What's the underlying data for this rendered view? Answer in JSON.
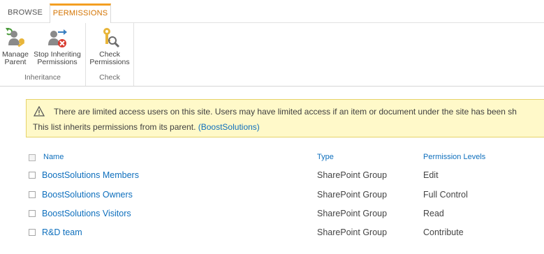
{
  "tabs": [
    {
      "label": "BROWSE",
      "active": false
    },
    {
      "label": "PERMISSIONS",
      "active": true
    }
  ],
  "ribbon": {
    "inheritance_group": {
      "label": "Inheritance",
      "buttons": [
        {
          "label_line1": "Manage",
          "label_line2": "Parent",
          "icon": "manage-parent-icon"
        },
        {
          "label_line1": "Stop Inheriting",
          "label_line2": "Permissions",
          "icon": "stop-inheriting-icon"
        }
      ]
    },
    "check_group": {
      "label": "Check",
      "buttons": [
        {
          "label_line1": "Check",
          "label_line2": "Permissions",
          "icon": "check-permissions-icon"
        }
      ]
    }
  },
  "warning": {
    "line1": "There are limited access users on this site. Users may have limited access if an item or document under the site has been sh",
    "line2_prefix": "This list inherits permissions from its parent.",
    "parent_link": "(BoostSolutions)"
  },
  "table": {
    "columns": [
      "Name",
      "Type",
      "Permission Levels"
    ],
    "rows": [
      {
        "name": "BoostSolutions Members",
        "type": "SharePoint Group",
        "level": "Edit"
      },
      {
        "name": "BoostSolutions Owners",
        "type": "SharePoint Group",
        "level": "Full Control"
      },
      {
        "name": "BoostSolutions Visitors",
        "type": "SharePoint Group",
        "level": "Read"
      },
      {
        "name": "R&D team",
        "type": "SharePoint Group",
        "level": "Contribute"
      }
    ]
  },
  "colors": {
    "accent_tab": "#d47300",
    "link": "#0e6fbd",
    "warning_bg": "#fff9c9"
  }
}
